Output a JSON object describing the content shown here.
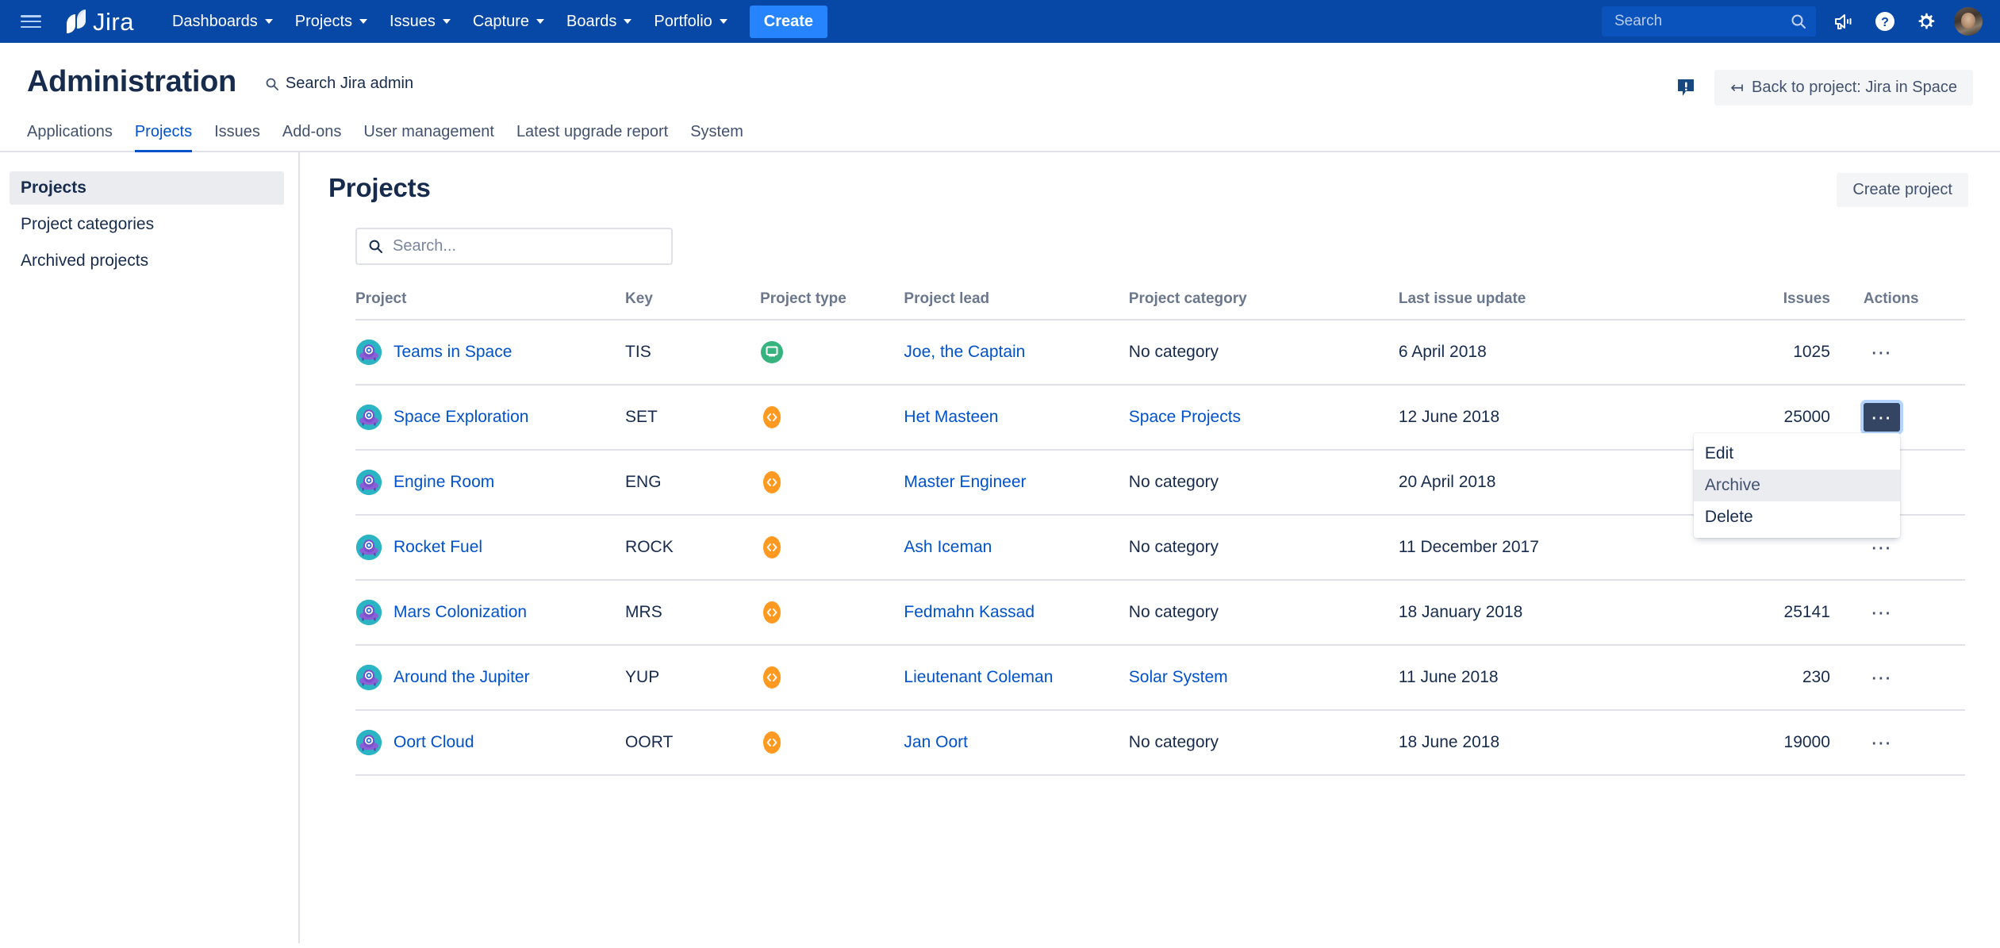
{
  "topnav": {
    "menu_icon": "hamburger-icon",
    "logo_text": "Jira",
    "items": [
      {
        "label": "Dashboards",
        "has_caret": true
      },
      {
        "label": "Projects",
        "has_caret": true
      },
      {
        "label": "Issues",
        "has_caret": true
      },
      {
        "label": "Capture",
        "has_caret": true
      },
      {
        "label": "Boards",
        "has_caret": true
      },
      {
        "label": "Portfolio",
        "has_caret": true
      }
    ],
    "create_label": "Create",
    "search_placeholder": "Search",
    "icons": [
      "megaphone-icon",
      "help-icon",
      "settings-gear-icon",
      "user-avatar"
    ]
  },
  "admin_header": {
    "title": "Administration",
    "search_label": "Search Jira admin",
    "notification_icon": "alert-bubble-icon",
    "back_button": "Back to project: Jira in Space",
    "back_arrow": "↤"
  },
  "admin_tabs": [
    {
      "label": "Applications",
      "active": false
    },
    {
      "label": "Projects",
      "active": true
    },
    {
      "label": "Issues",
      "active": false
    },
    {
      "label": "Add-ons",
      "active": false
    },
    {
      "label": "User management",
      "active": false
    },
    {
      "label": "Latest upgrade report",
      "active": false
    },
    {
      "label": "System",
      "active": false
    }
  ],
  "sidebar": {
    "items": [
      {
        "label": "Projects",
        "active": true
      },
      {
        "label": "Project categories",
        "active": false
      },
      {
        "label": "Archived projects",
        "active": false
      }
    ]
  },
  "main": {
    "page_title": "Projects",
    "create_project_label": "Create project",
    "search_placeholder": "Search...",
    "search_value": "",
    "table": {
      "columns": [
        "Project",
        "Key",
        "Project type",
        "Project lead",
        "Project category",
        "Last issue update",
        "Issues",
        "Actions"
      ],
      "rows": [
        {
          "project": "Teams in Space",
          "key": "TIS",
          "type_icon": "business-project-icon",
          "type_color": "#36B37E",
          "lead": "Joe, the Captain",
          "category": "No category",
          "category_link": false,
          "last_update": "6 April 2018",
          "issues": "1025",
          "actions_active": false
        },
        {
          "project": "Space Exploration",
          "key": "SET",
          "type_icon": "software-project-icon",
          "type_color": "#FF991F",
          "lead": "Het Masteen",
          "category": "Space Projects",
          "category_link": true,
          "last_update": "12 June 2018",
          "issues": "25000",
          "actions_active": true
        },
        {
          "project": "Engine Room",
          "key": "ENG",
          "type_icon": "software-project-icon",
          "type_color": "#FF991F",
          "lead": "Master Engineer",
          "category": "No category",
          "category_link": false,
          "last_update": "20 April 2018",
          "issues": "",
          "actions_active": false
        },
        {
          "project": "Rocket Fuel",
          "key": "ROCK",
          "type_icon": "software-project-icon",
          "type_color": "#FF991F",
          "lead": "Ash Iceman",
          "category": "No category",
          "category_link": false,
          "last_update": "11 December 2017",
          "issues": "",
          "actions_active": false
        },
        {
          "project": "Mars Colonization",
          "key": "MRS",
          "type_icon": "software-project-icon",
          "type_color": "#FF991F",
          "lead": "Fedmahn Kassad",
          "category": "No category",
          "category_link": false,
          "last_update": "18 January 2018",
          "issues": "25141",
          "actions_active": false
        },
        {
          "project": "Around the Jupiter",
          "key": "YUP",
          "type_icon": "software-project-icon",
          "type_color": "#FF991F",
          "lead": "Lieutenant Coleman",
          "category": "Solar System",
          "category_link": true,
          "last_update": "11 June 2018",
          "issues": "230",
          "actions_active": false
        },
        {
          "project": "Oort Cloud",
          "key": "OORT",
          "type_icon": "software-project-icon",
          "type_color": "#FF991F",
          "lead": "Jan Oort",
          "category": "No category",
          "category_link": false,
          "last_update": "18 June 2018",
          "issues": "19000",
          "actions_active": false
        }
      ]
    },
    "actions_dropdown": {
      "open": true,
      "items": [
        {
          "label": "Edit",
          "hovered": false
        },
        {
          "label": "Archive",
          "hovered": true
        },
        {
          "label": "Delete",
          "hovered": false
        }
      ]
    }
  },
  "colors": {
    "nav_bg": "#0747A6",
    "create_blue": "#2684FF",
    "link_blue": "#0052CC",
    "text_dark": "#172B4D",
    "border": "#DFE1E6",
    "business_green": "#36B37E",
    "software_orange": "#FF991F",
    "active_btn": "#344563",
    "focus_ring": "#B3D4FF"
  }
}
